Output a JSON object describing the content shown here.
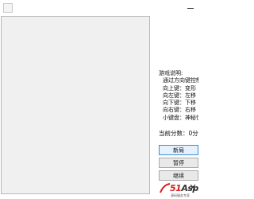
{
  "instructions": {
    "title": "游戏说明:",
    "lines": [
      "通过方向键控制",
      "向上键：变形",
      "向左键：左移",
      "向下键：下移",
      "向右键：右移",
      "小键盘：神秘惊"
    ]
  },
  "score": {
    "label": "当前分数：0分"
  },
  "buttons": {
    "new_game": "新局",
    "pause": "暂停",
    "continue": "继续"
  },
  "watermark": {
    "brand_prefix": "51",
    "brand_suffix": "Aspx",
    "tagline": "源码服务专家"
  },
  "colors": {
    "board_bg": "#f0f0f0",
    "button_bg": "#e9e9e9",
    "focus_border": "#3c8be0",
    "watermark_red": "#d62020"
  }
}
